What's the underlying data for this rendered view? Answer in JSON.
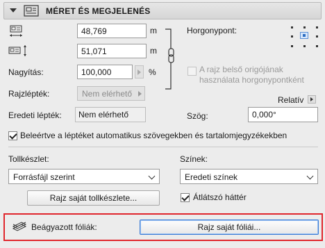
{
  "section": {
    "title": "MÉRET ÉS MEGJELENÉS"
  },
  "size": {
    "width_value": "48,769",
    "height_value": "51,071",
    "unit": "m",
    "magnification_label": "Nagyítás:",
    "magnification_value": "100,000",
    "magnification_unit": "%"
  },
  "scale": {
    "drawing_scale_label": "Rajzlépték:",
    "drawing_scale_value": "Nem elérhető",
    "original_scale_label": "Eredeti lépték:",
    "original_scale_value": "Nem elérhető"
  },
  "anchor": {
    "label": "Horgonypont:",
    "use_origin_label_line1": "A rajz belső origójának",
    "use_origin_label_line2": "használata horgonypontként",
    "relative_label": "Relatív",
    "angle_label": "Szög:",
    "angle_value": "0,000°"
  },
  "include_scale_checkbox_label": "Beleértve a léptéket automatikus szövegekben és tartalomjegyzékekben",
  "pens": {
    "label": "Tollkészlet:",
    "selected": "Forrásfájl szerint",
    "custom_button": "Rajz saját tollkészlete..."
  },
  "colors": {
    "label": "Színek:",
    "selected": "Eredeti színek",
    "transparent_label": "Átlátszó háttér"
  },
  "layers": {
    "label": "Beágyazott fóliák:",
    "button": "Rajz saját fóliái..."
  }
}
